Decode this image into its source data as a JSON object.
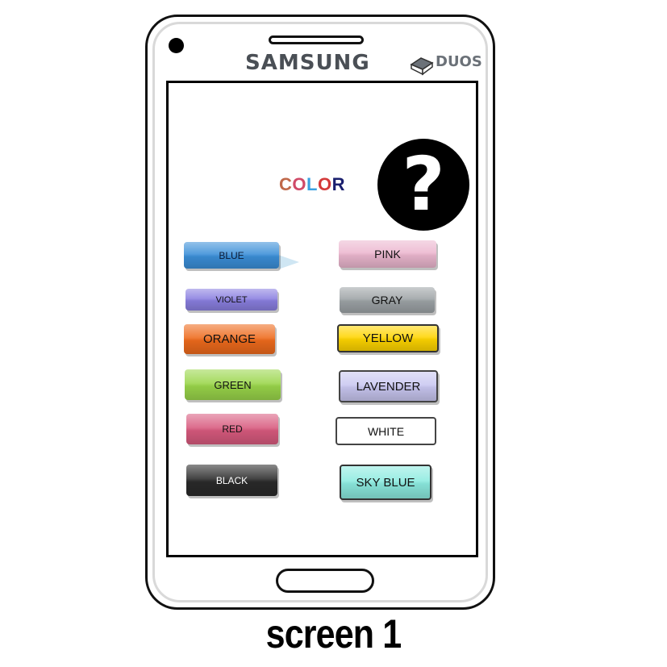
{
  "device": {
    "brand": "SAMSUNG",
    "model_badge": "DUOS"
  },
  "screen": {
    "title_letters": [
      {
        "ch": "C",
        "color": "#c0694a"
      },
      {
        "ch": "O",
        "color": "#d04a68"
      },
      {
        "ch": "L",
        "color": "#3aa0e0"
      },
      {
        "ch": "O",
        "color": "#d43a3a"
      },
      {
        "ch": "R",
        "color": "#1a1f6e"
      }
    ],
    "help_icon": "question-circle-icon",
    "buttons": [
      {
        "id": "blue",
        "label": "BLUE",
        "bg": "#3b8fd8",
        "fg": "#0b1a33",
        "selected": true
      },
      {
        "id": "pink",
        "label": "PINK",
        "bg": "#ecb7cf",
        "fg": "#111111"
      },
      {
        "id": "violet",
        "label": "VIOLET",
        "bg": "#8a7fe0",
        "fg": "#111111"
      },
      {
        "id": "gray",
        "label": "GRAY",
        "bg": "#9da3a6",
        "fg": "#111111"
      },
      {
        "id": "orange",
        "label": "ORANGE",
        "bg": "#ee6a1c",
        "fg": "#111111"
      },
      {
        "id": "yellow",
        "label": "YELLOW",
        "bg": "#ffd500",
        "fg": "#111111"
      },
      {
        "id": "green",
        "label": "GREEN",
        "bg": "#9ad64a",
        "fg": "#111111"
      },
      {
        "id": "lavender",
        "label": "LAVENDER",
        "bg": "#c9c7f1",
        "fg": "#111111"
      },
      {
        "id": "red",
        "label": "RED",
        "bg": "#d85a7e",
        "fg": "#111111"
      },
      {
        "id": "white",
        "label": "WHITE",
        "bg": "#ffffff",
        "fg": "#111111"
      },
      {
        "id": "black",
        "label": "BLACK",
        "bg": "#2a2a2a",
        "fg": "#ffffff"
      },
      {
        "id": "sky-blue",
        "label": "SKY BLUE",
        "bg": "#8cebe0",
        "fg": "#111111"
      }
    ]
  },
  "caption": "screen 1"
}
